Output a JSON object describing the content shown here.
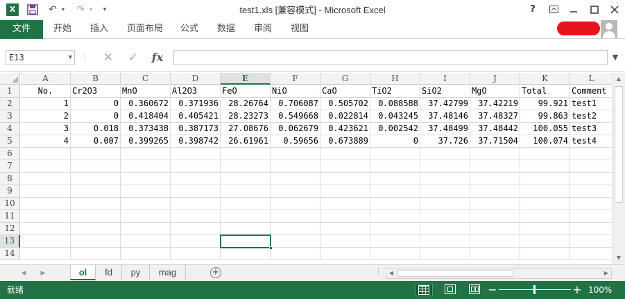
{
  "app": {
    "icon_letter": "X",
    "title": "test1.xls  [兼容模式] - Microsoft Excel",
    "accent_color": "#217346",
    "quick_access": {
      "save_icon": "save-icon",
      "undo_icon": "undo-icon",
      "redo_icon": "redo-icon",
      "customize_icon": "customize-qat-icon"
    },
    "window_buttons": {
      "help": "?",
      "ribbon_display_icon": "ribbon-display-icon",
      "minimize_icon": "minimize-icon",
      "maximize_icon": "maximize-icon",
      "close_icon": "close-icon"
    }
  },
  "ribbon": {
    "file_tab": "文件",
    "tabs": [
      "开始",
      "插入",
      "页面布局",
      "公式",
      "数据",
      "审阅",
      "视图"
    ]
  },
  "formula_bar": {
    "name_box": "E13",
    "formula": "",
    "cancel_icon": "cancel-icon",
    "enter_icon": "enter-icon",
    "fx_label": "fx"
  },
  "sheet": {
    "columns": [
      "A",
      "B",
      "C",
      "D",
      "E",
      "F",
      "G",
      "H",
      "I",
      "J",
      "K",
      "L"
    ],
    "selected_column": "E",
    "selected_row": "13",
    "active_cell": "E13",
    "row_numbers": [
      "1",
      "2",
      "3",
      "4",
      "5",
      "6",
      "7",
      "8",
      "9",
      "10",
      "11",
      "12",
      "13",
      "14"
    ],
    "header_row": [
      "No.",
      "Cr2O3",
      "MnO",
      "Al2O3",
      "FeO",
      "NiO",
      "CaO",
      "TiO2",
      "SiO2",
      "MgO",
      "Total",
      "Comment"
    ],
    "rows": [
      [
        "1",
        "0",
        "0.360672",
        "0.371936",
        "28.26764",
        "0.706087",
        "0.505702",
        "0.088588",
        "37.42799",
        "37.42219",
        "99.921",
        "test1"
      ],
      [
        "2",
        "0",
        "0.418404",
        "0.405421",
        "28.23273",
        "0.549668",
        "0.022814",
        "0.043245",
        "37.48146",
        "37.48327",
        "99.863",
        "test2"
      ],
      [
        "3",
        "0.018",
        "0.373438",
        "0.387173",
        "27.08676",
        "0.062679",
        "0.423621",
        "0.002542",
        "37.48499",
        "37.48442",
        "100.055",
        "test3"
      ],
      [
        "4",
        "0.007",
        "0.399265",
        "0.398742",
        "26.61961",
        "0.59656",
        "0.673889",
        "0",
        "37.726",
        "37.71504",
        "100.074",
        "test4"
      ]
    ]
  },
  "sheet_tabs": {
    "tabs": [
      "ol",
      "fd",
      "py",
      "mag"
    ],
    "active": "ol",
    "add_label": "+"
  },
  "status": {
    "text": "就绪",
    "zoom": "100%",
    "zoom_minus": "−",
    "zoom_plus": "+"
  }
}
